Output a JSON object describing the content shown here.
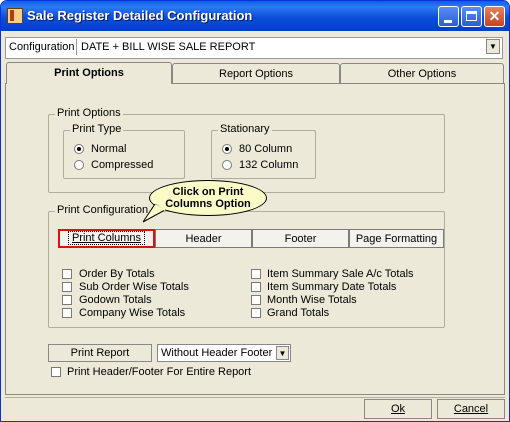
{
  "window": {
    "title": "Sale Register Detailed Configuration"
  },
  "config": {
    "label": "Configuration",
    "value": "DATE + BILL WISE SALE REPORT"
  },
  "tabs": [
    {
      "label": "Print Options",
      "active": true
    },
    {
      "label": "Report Options",
      "active": false
    },
    {
      "label": "Other Options",
      "active": false
    }
  ],
  "print_options": {
    "group_label": "Print Options",
    "print_type": {
      "label": "Print Type",
      "options": [
        "Normal",
        "Compressed"
      ],
      "selected": "Normal"
    },
    "stationary": {
      "label": "Stationary",
      "options": [
        "80 Column",
        "132 Column"
      ],
      "selected": "80 Column"
    }
  },
  "print_config": {
    "group_label": "Print Configuration",
    "buttons": [
      "Print Columns",
      "Header",
      "Footer",
      "Page Formatting"
    ],
    "callout": "Click on Print Columns Option",
    "checks_left": [
      "Order By Totals",
      "Sub Order Wise Totals",
      "Godown Totals",
      "Company Wise Totals"
    ],
    "checks_right": [
      "Item Summary Sale A/c Totals",
      "Item Summary Date Totals",
      "Month Wise Totals",
      "Grand Totals"
    ]
  },
  "print_report": {
    "label": "Print Report",
    "value": "Without Header Footer"
  },
  "header_footer_check": "Print Header/Footer For Entire Report",
  "actions": {
    "ok": "Ok",
    "cancel": "Cancel"
  }
}
